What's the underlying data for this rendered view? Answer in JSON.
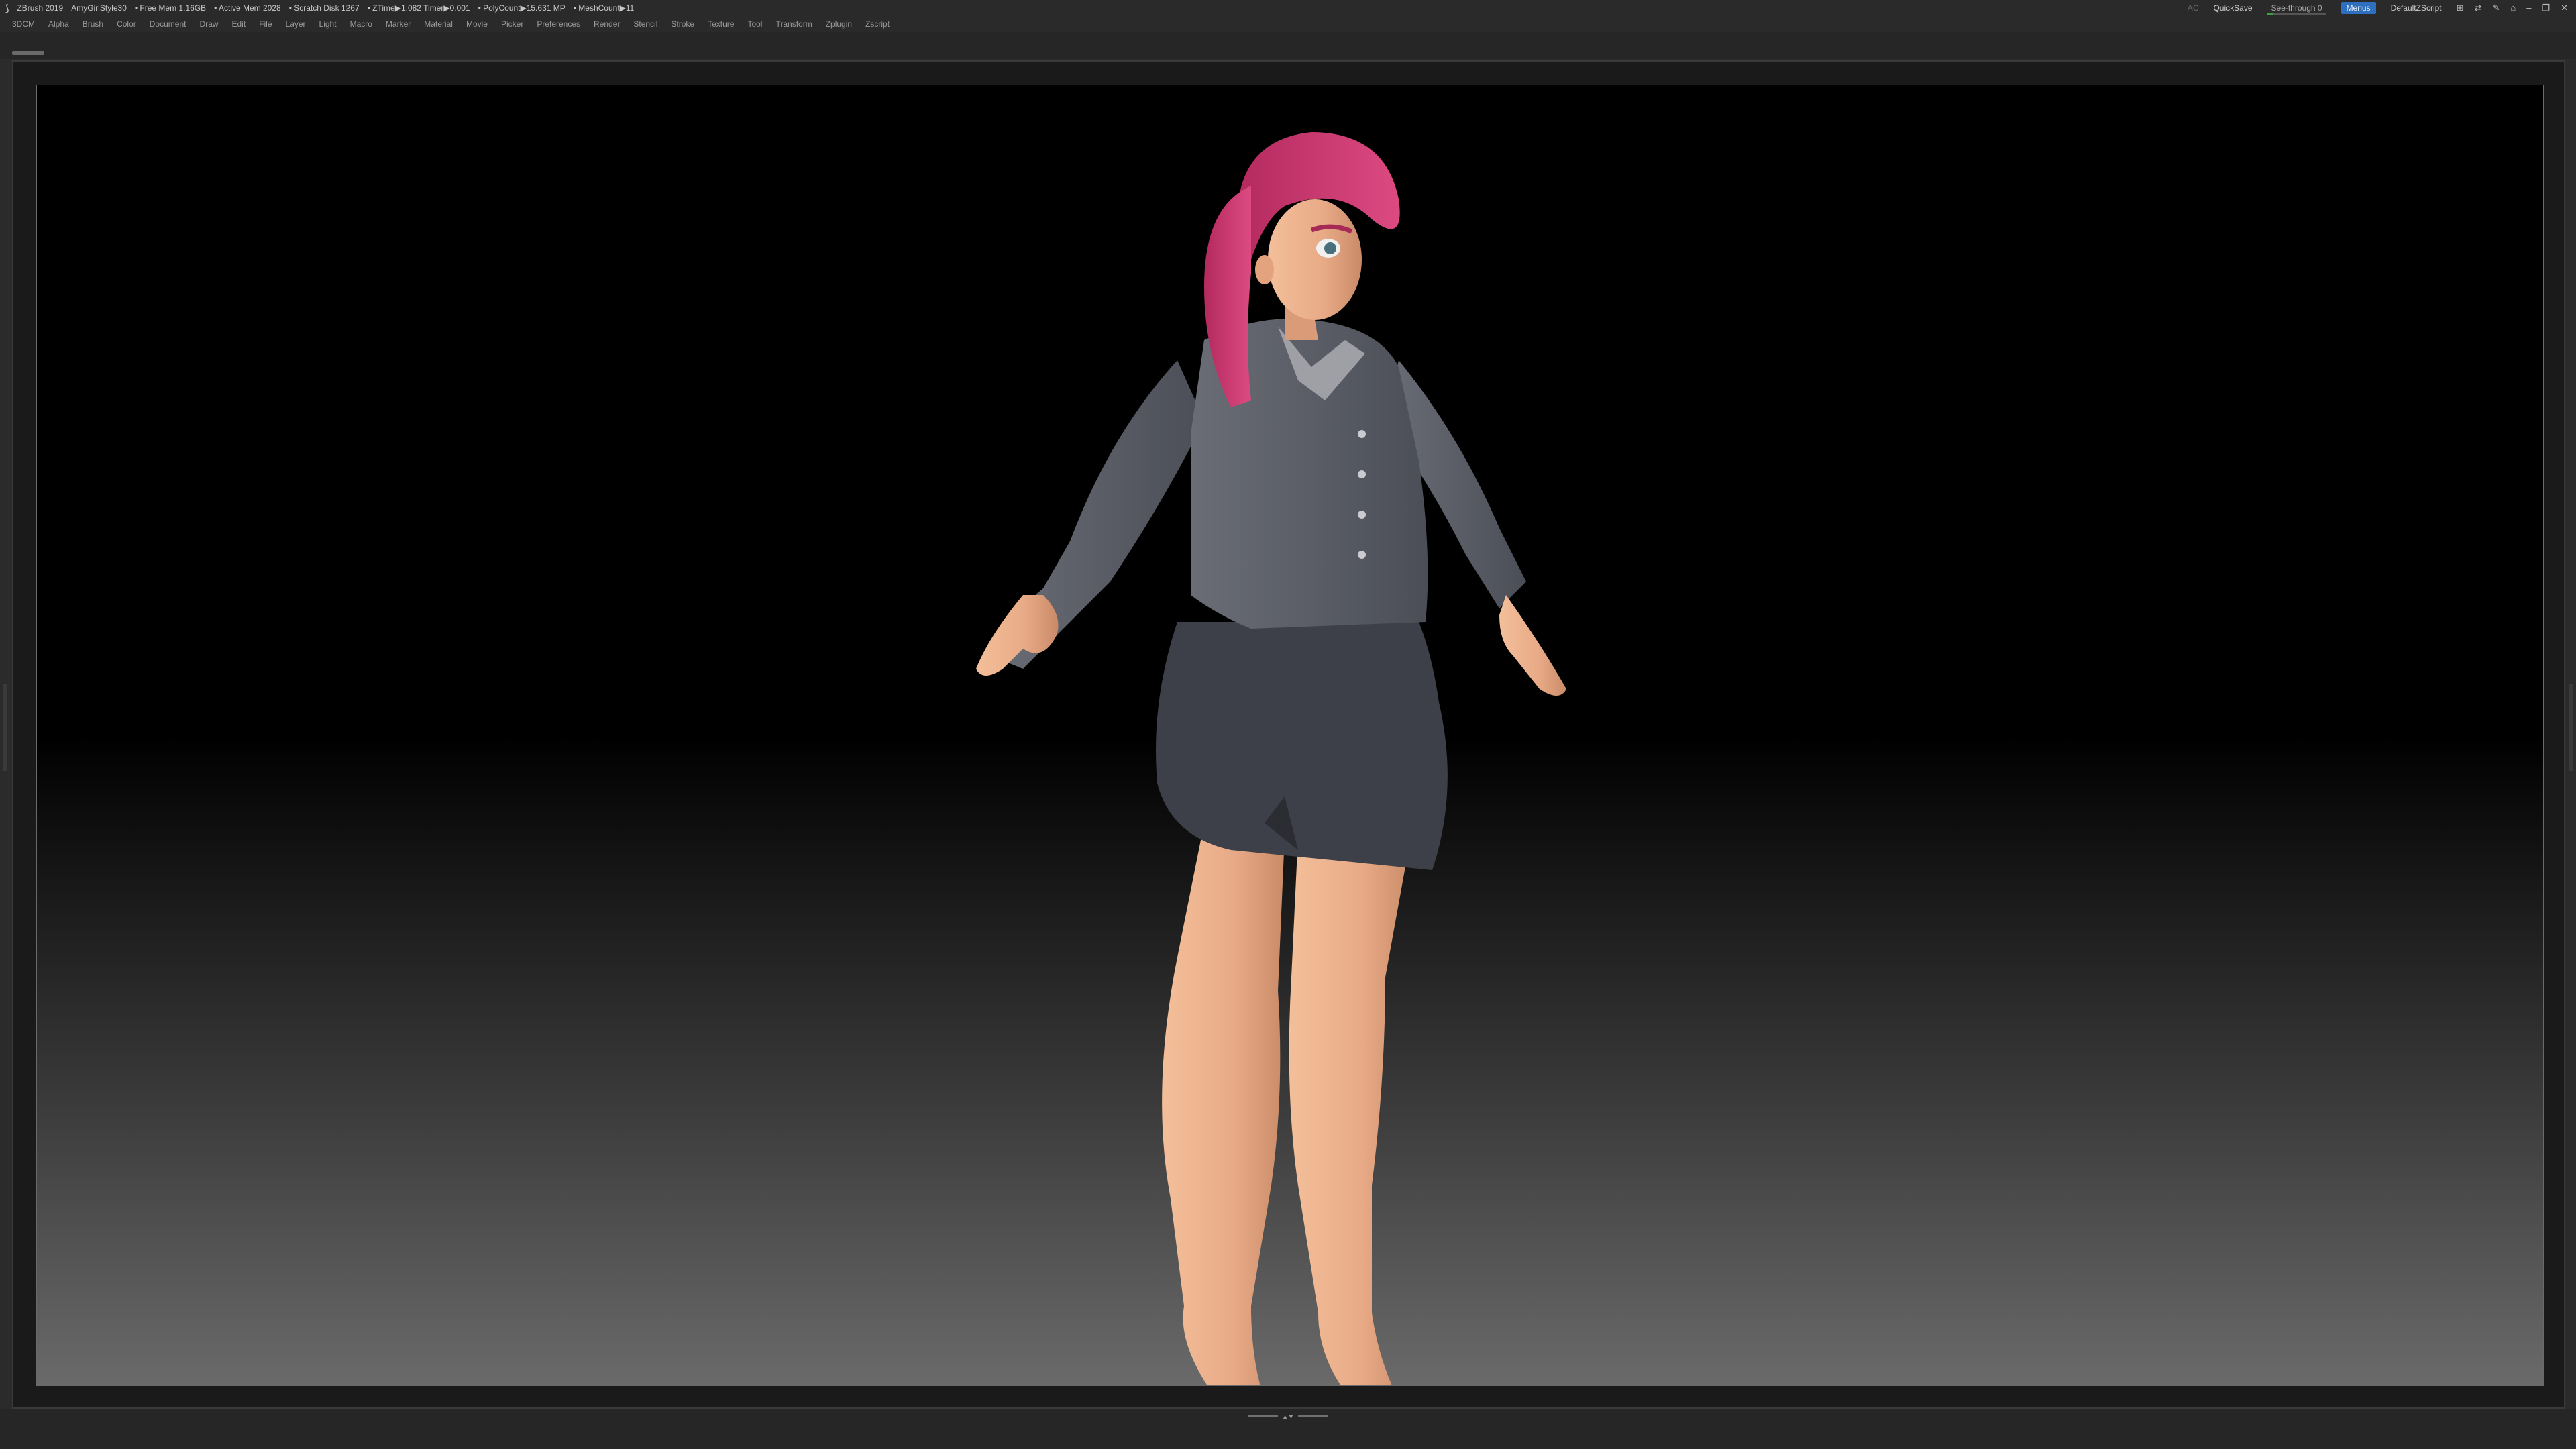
{
  "titlebar": {
    "app": "ZBrush 2019",
    "document": "AmyGirlStyle30",
    "free_mem": "• Free Mem 1.16GB",
    "active_mem": "• Active Mem 2028",
    "scratch": "• Scratch Disk 1267",
    "ztime": "• ZTime▶1.082 Timer▶0.001",
    "polycount": "• PolyCount▶15.631 MP",
    "meshcount": "• MeshCount▶11",
    "ac": "AC",
    "quicksave": "QuickSave",
    "see_through": "See-through  0",
    "menus": "Menus",
    "script": "DefaultZScript"
  },
  "menubar": [
    "3DCM",
    "Alpha",
    "Brush",
    "Color",
    "Document",
    "Draw",
    "Edit",
    "File",
    "Layer",
    "Light",
    "Macro",
    "Marker",
    "Material",
    "Movie",
    "Picker",
    "Preferences",
    "Render",
    "Stencil",
    "Stroke",
    "Texture",
    "Tool",
    "Transform",
    "Zplugin",
    "Zscript"
  ],
  "colors": {
    "hair": "#c8326a",
    "skin": "#e8aa86",
    "jacket": "#575a63",
    "skirt": "#3d4048",
    "accent_blue": "#2f6fc0"
  },
  "icons": {
    "app": "zbrush-icon",
    "window": [
      "layout-icon",
      "cycle-icon",
      "brush-palette-icon",
      "lock-icon",
      "minimize-icon",
      "restore-icon",
      "close-icon"
    ]
  }
}
